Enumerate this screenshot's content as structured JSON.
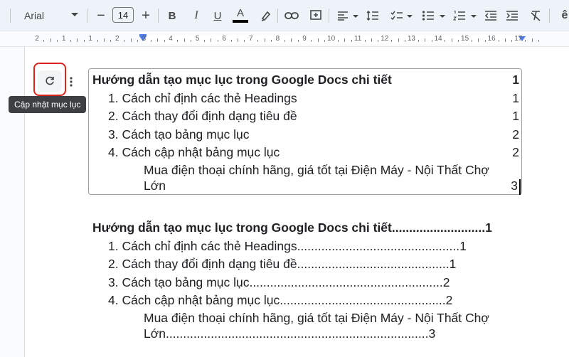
{
  "toolbar": {
    "font_family": "Arial",
    "font_size": "14",
    "bold_label": "B",
    "italic_label": "I",
    "underline_label": "U",
    "text_color_label": "A",
    "decrease_size_label": "−",
    "increase_size_label": "+",
    "overflow_label": "ê",
    "text_color_swatch": "#000000"
  },
  "ruler": {
    "labels": [
      "2",
      "1",
      "1",
      "2",
      "3",
      "4",
      "5",
      "6",
      "7",
      "8",
      "9",
      "10",
      "11",
      "12",
      "13",
      "14",
      "15",
      "16",
      "17"
    ]
  },
  "toc_actions": {
    "tooltip": "Cập nhật mục lục"
  },
  "toc_linked": {
    "title": {
      "text": "Hướng dẫn tạo mục lục trong Google Docs chi tiết",
      "page": "1"
    },
    "items": [
      {
        "text": "1. Cách chỉ định các thẻ Headings",
        "page": "1"
      },
      {
        "text": "2. Cách thay đổi định dạng tiêu đề",
        "page": "1"
      },
      {
        "text": "3. Cách tạo bảng mục lục",
        "page": "2"
      },
      {
        "text": "4. Cách cập nhật bảng mục lục",
        "page": "2"
      }
    ],
    "sub_item": {
      "line1": "Mua điện thoại chính hãng, giá tốt tại Điện Máy - Nội Thất Chợ",
      "line2": "Lớn",
      "page": "3"
    }
  },
  "toc_dotted": {
    "title": {
      "text": "Hướng dẫn tạo mục lục trong Google Docs chi tiết",
      "dots": "...........................",
      "page": "1"
    },
    "items": [
      {
        "text": "1. Cách chỉ định các thẻ Headings",
        "dots": "...............................................",
        "page": "1"
      },
      {
        "text": "2. Cách thay đổi định dạng tiêu đề",
        "dots": "............................................",
        "page": "1"
      },
      {
        "text": "3. Cách tạo bảng mục lục",
        "dots": "........................................................",
        "page": "2"
      },
      {
        "text": "4. Cách cập nhật bảng mục lục",
        "dots": "................................................",
        "page": "2"
      }
    ],
    "sub_item": {
      "line1": "Mua điện thoại chính hãng, giá tốt tại Điện Máy - Nội Thất Chợ",
      "line2": "Lớn",
      "dots": "............................................................................",
      "page": "3"
    }
  },
  "colors": {
    "highlight_border": "#d9251d",
    "indent_marker": "#4f7be8"
  }
}
